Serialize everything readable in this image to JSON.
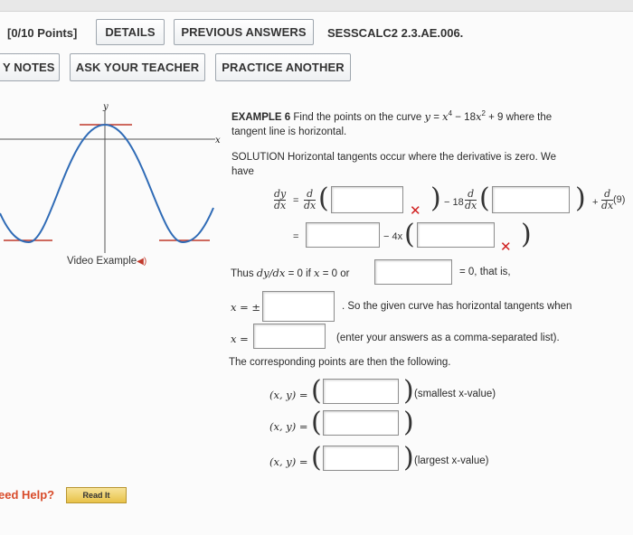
{
  "header": {
    "points": "[0/10 Points]",
    "details": "DETAILS",
    "previous_answers": "PREVIOUS ANSWERS",
    "problem_id": "SESSCALC2 2.3.AE.006."
  },
  "subnav": {
    "my_notes": "Y NOTES",
    "ask_teacher": "ASK YOUR TEACHER",
    "practice_another": "PRACTICE ANOTHER"
  },
  "graph": {
    "y_label": "y",
    "x_label": "x",
    "video_example": "Video Example",
    "speaker_icon": "speaker-icon"
  },
  "example": {
    "label": "EXAMPLE 6",
    "text_a": "Find the points on the curve ",
    "curve_y": "y",
    "eq": " = ",
    "term1": "x",
    "exp1": "4",
    "minus": " − 18",
    "term2": "x",
    "exp2": "2",
    "plus": " + 9",
    "text_b": " where the",
    "line2": "tangent line is horizontal."
  },
  "solution": {
    "label": "SOLUTION",
    "text": "Horizontal tangents occur where the derivative is zero. We",
    "text2": "have"
  },
  "derivative": {
    "dy": "dy",
    "dx": "dx",
    "d": "d",
    "eq": "=",
    "minus18": "− 18",
    "plus": "+",
    "nine": "(9)",
    "eq2": "=",
    "minus4x": "− 4x",
    "closing_paren": ")"
  },
  "conclusion": {
    "thus": "Thus",
    "dydx": "dy/dx",
    "eq0_if": "= 0  if",
    "x": "x",
    "eq0_or": "= 0  or",
    "eq0_that": "= 0, that is,",
    "x_pm_label": "x = ±",
    "so_text": ". So the given curve has horizontal tangents when",
    "x_eq_label": "x =",
    "list_hint": "(enter your answers as a comma-separated list).",
    "points_intro": "The corresponding points are then the following.",
    "xy_label": "(x, y) =",
    "hint_small": "(smallest x-value)",
    "hint_large": "(largest x-value)"
  },
  "help": {
    "need_help": "eed Help?",
    "read_it": "Read It"
  },
  "colors": {
    "wrong_mark": "#d02020",
    "curve": "#2f6bb6",
    "tangent": "#c0392b",
    "help_text": "#d84b2a"
  }
}
